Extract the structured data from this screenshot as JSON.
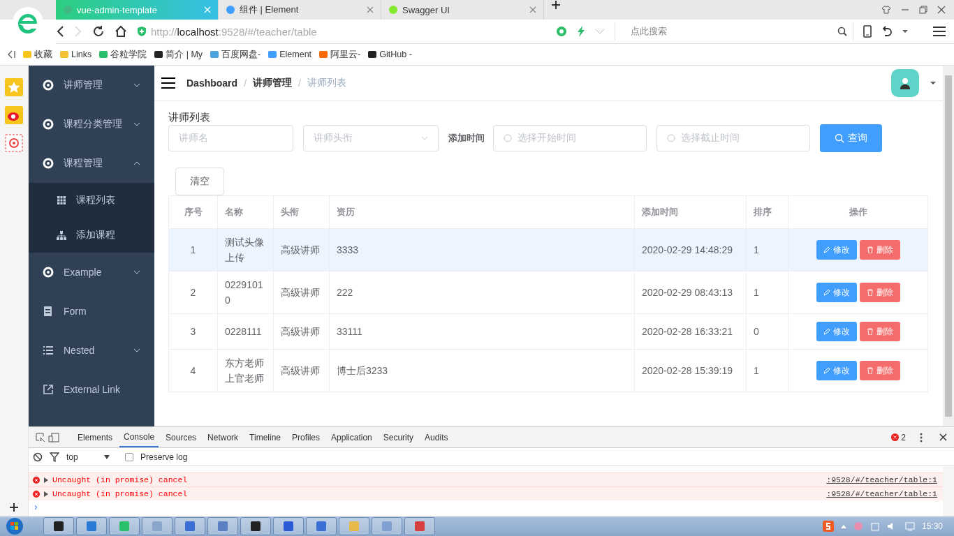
{
  "browser": {
    "tabs": [
      {
        "title": "vue-admin-template",
        "selected": true
      },
      {
        "title": "组件 | Element",
        "selected": false
      },
      {
        "title": "Swagger UI",
        "selected": false
      }
    ],
    "address": {
      "scheme": "http://",
      "host": "localhost",
      "path": ":9528/#/teacher/table"
    },
    "search": {
      "placeholder": "点此搜索"
    },
    "bookmarks": [
      "收藏",
      "Links",
      "谷粒学院",
      "简介 | My",
      "百度网盘-",
      "Element",
      "阿里云-",
      "GitHub -"
    ]
  },
  "sidebar": {
    "items": [
      {
        "label": "讲师管理",
        "kind": "submenu",
        "expanded": false
      },
      {
        "label": "课程分类管理",
        "kind": "submenu",
        "expanded": false
      },
      {
        "label": "课程管理",
        "kind": "submenu",
        "expanded": true,
        "children": [
          {
            "label": "课程列表"
          },
          {
            "label": "添加课程"
          }
        ]
      },
      {
        "label": "Example",
        "kind": "submenu",
        "expanded": false
      },
      {
        "label": "Form",
        "kind": "item"
      },
      {
        "label": "Nested",
        "kind": "submenu",
        "expanded": false
      },
      {
        "label": "External Link",
        "kind": "item"
      }
    ]
  },
  "navbar": {
    "breadcrumb": [
      "Dashboard",
      "讲师管理",
      "讲师列表"
    ],
    "separator": "/"
  },
  "page": {
    "heading": "讲师列表",
    "filters": {
      "name": {
        "placeholder": "讲师名"
      },
      "level": {
        "placeholder": "讲师头衔"
      },
      "time_label": "添加时间",
      "begin": {
        "placeholder": "选择开始时间"
      },
      "end": {
        "placeholder": "选择截止时间"
      },
      "query_button": "查询",
      "clear_button": "清空"
    },
    "table": {
      "columns": [
        "序号",
        "名称",
        "头衔",
        "资历",
        "添加时间",
        "排序",
        "操作"
      ],
      "rows": [
        {
          "index": "1",
          "name": "测试头像上传",
          "title": "高级讲师",
          "career": "3333",
          "time": "2020-02-29 14:48:29",
          "sort": "1",
          "selected": true,
          "actions": [
            "修改",
            "删除"
          ]
        },
        {
          "index": "2",
          "name": "02291010",
          "title": "高级讲师",
          "career": "222",
          "time": "2020-02-29 08:43:13",
          "sort": "1",
          "selected": false,
          "actions": [
            "修改",
            "删除"
          ]
        },
        {
          "index": "3",
          "name": "0228111",
          "title": "高级讲师",
          "career": "33111",
          "time": "2020-02-28 16:33:21",
          "sort": "0",
          "selected": false,
          "actions": [
            "修改",
            "删除"
          ]
        },
        {
          "index": "4",
          "name": "东方老师上官老师",
          "title": "高级讲师",
          "career": "博士后3233",
          "time": "2020-02-28 15:39:19",
          "sort": "1",
          "selected": false,
          "actions": [
            "修改",
            "删除"
          ]
        }
      ]
    }
  },
  "devtools": {
    "tabs": [
      {
        "label": "Elements",
        "selected": false
      },
      {
        "label": "Console",
        "selected": true
      },
      {
        "label": "Sources",
        "selected": false
      },
      {
        "label": "Network",
        "selected": false
      },
      {
        "label": "Timeline",
        "selected": false
      },
      {
        "label": "Profiles",
        "selected": false
      },
      {
        "label": "Application",
        "selected": false
      },
      {
        "label": "Security",
        "selected": false
      },
      {
        "label": "Audits",
        "selected": false
      }
    ],
    "error_count": "2",
    "context": "top",
    "preserve_log": {
      "label": "Preserve log",
      "checked": false
    },
    "messages": [
      {
        "text": "Uncaught (in promise) cancel",
        "source": ":9528/#/teacher/table:1"
      },
      {
        "text": "Uncaught (in promise) cancel",
        "source": ":9528/#/teacher/table:1"
      }
    ],
    "prompt": "›"
  },
  "taskbar": {
    "clock": "15:30"
  }
}
